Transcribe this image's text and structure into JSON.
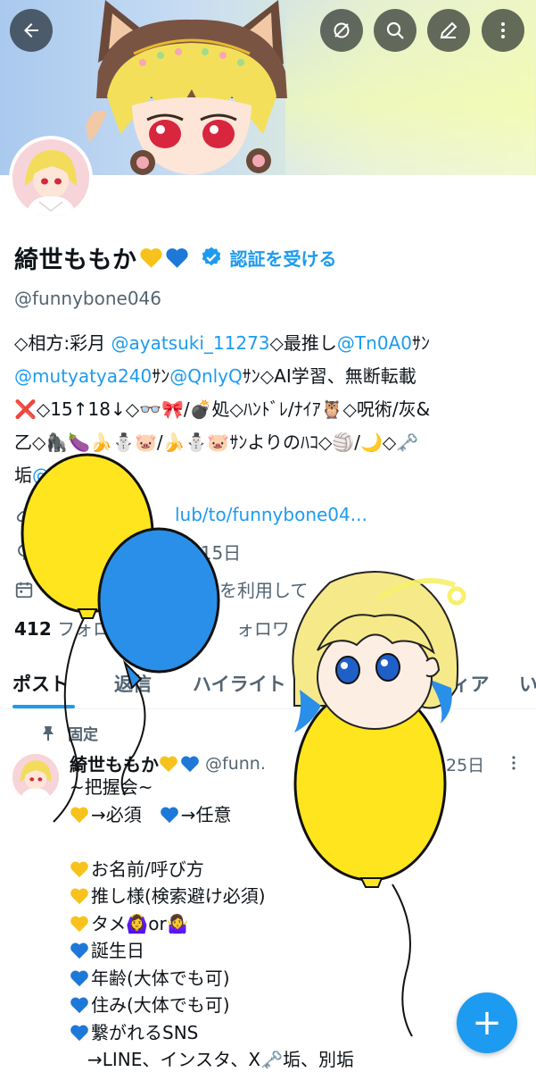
{
  "profile": {
    "display_name": "綺世ももか",
    "verify_cta": "認証を受ける",
    "handle": "@funnybone046",
    "bio_lines": [
      [
        {
          "t": "◇相方:彩月 "
        },
        {
          "t": "@ayatsuki_11273",
          "m": true
        },
        {
          "t": "◇最推し"
        },
        {
          "t": "@Tn0A0",
          "m": true
        },
        {
          "t": "ｻﾝ"
        }
      ],
      [
        {
          "t": "@mutyatya240",
          "m": true
        },
        {
          "t": "ｻﾝ"
        },
        {
          "t": "@QnlyQ",
          "m": true
        },
        {
          "t": "ｻﾝ◇AI学習、無断転載"
        }
      ],
      [
        {
          "t": "❌◇15↑18↓◇👓🎀/💣処◇ﾊﾝﾄﾞﾚ/ﾅｲｱ🦉◇呪術/灰&"
        }
      ],
      [
        {
          "t": "乙◇🦍🍆🍌⛄🐷/🍌⛄🐷ｻﾝよりのﾊｺ◇🏐/🌙◇🗝️"
        }
      ],
      [
        {
          "t": "垢"
        },
        {
          "t": "@nesabu",
          "m": true
        }
      ]
    ],
    "link_text": "lub/to/funnybone04...",
    "birthday_text": "5月15日",
    "joined_text": "を利用して",
    "following_count": "412",
    "following_label": "フォロ",
    "followers_label": "ォロワ"
  },
  "tabs": [
    {
      "label": "ポスト",
      "active": true
    },
    {
      "label": "返信",
      "active": false
    },
    {
      "label": "ハイライト",
      "active": false
    },
    {
      "label": "ディア",
      "active": false
    },
    {
      "label": "い",
      "active": false
    }
  ],
  "pinned_post": {
    "pinned_label": "固定",
    "author_name": "綺世ももか",
    "author_handle": "@funn.",
    "date": "25日",
    "body_lines": [
      [
        {
          "t": "~把握会~"
        }
      ],
      [
        {
          "h": "y"
        },
        {
          "t": "→必須　"
        },
        {
          "h": "b"
        },
        {
          "t": "→任意"
        }
      ],
      [
        {
          "t": ""
        }
      ],
      [
        {
          "h": "y"
        },
        {
          "t": "お名前/呼び方"
        }
      ],
      [
        {
          "h": "y"
        },
        {
          "t": "推し様(検索避け必須)"
        }
      ],
      [
        {
          "h": "y"
        },
        {
          "t": "タメ🙆‍♀️or🤷‍♀️"
        }
      ],
      [
        {
          "h": "b"
        },
        {
          "t": "誕生日"
        }
      ],
      [
        {
          "h": "b"
        },
        {
          "t": "年齢(大体でも可)"
        }
      ],
      [
        {
          "h": "b"
        },
        {
          "t": "住み(大体でも可)"
        }
      ],
      [
        {
          "h": "b"
        },
        {
          "t": "繋がれるSNS"
        }
      ],
      [
        {
          "t": "　→LINE、インスタ、X🗝️垢、別垢"
        }
      ]
    ]
  },
  "icons": {
    "back": "arrow-left-icon",
    "mute": "no-entry-icon",
    "search": "search-icon",
    "edit": "pencil-icon",
    "more": "more-vertical-icon",
    "verified": "verified-badge-icon",
    "link": "link-icon",
    "birthday": "balloon-icon",
    "calendar": "calendar-icon",
    "pin": "pin-icon",
    "compose": "plus-icon"
  },
  "colors": {
    "accent": "#1d9bf0",
    "text": "#0f1419",
    "secondary": "#536471",
    "heart_yellow": "#f7c21b",
    "heart_blue": "#1e78d7"
  }
}
